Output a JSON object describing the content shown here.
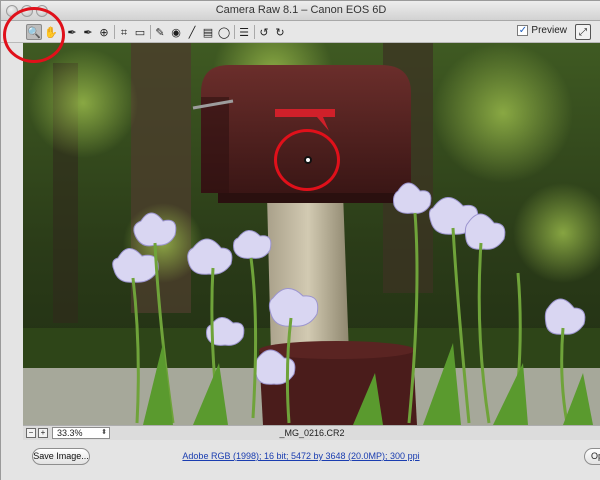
{
  "window": {
    "title": "Camera Raw 8.1  –  Canon EOS 6D"
  },
  "toolbar": {
    "tools": [
      {
        "name": "zoom-tool-icon",
        "glyph": "🔍"
      },
      {
        "name": "hand-tool-icon",
        "glyph": "✋"
      },
      {
        "name": "white-balance-tool-icon",
        "glyph": "✒"
      },
      {
        "name": "color-sampler-tool-icon",
        "glyph": "✒"
      },
      {
        "name": "targeted-adjustment-tool-icon",
        "glyph": "⊕"
      },
      {
        "name": "crop-tool-icon",
        "glyph": "⌗"
      },
      {
        "name": "straighten-tool-icon",
        "glyph": "▭"
      },
      {
        "name": "spot-removal-tool-icon",
        "glyph": "✎"
      },
      {
        "name": "red-eye-removal-tool-icon",
        "glyph": "◉"
      },
      {
        "name": "adjustment-brush-icon",
        "glyph": "╱"
      },
      {
        "name": "graduated-filter-icon",
        "glyph": "▤"
      },
      {
        "name": "radial-filter-icon",
        "glyph": "◯"
      },
      {
        "name": "preferences-icon",
        "glyph": "☰"
      },
      {
        "name": "rotate-left-icon",
        "glyph": "↺"
      },
      {
        "name": "rotate-right-icon",
        "glyph": "↻"
      }
    ],
    "preview_checked_glyph": "✓",
    "preview_label": "Preview",
    "fullscreen_glyph": "⤢"
  },
  "status": {
    "zoom_out_glyph": "−",
    "zoom_in_glyph": "+",
    "zoom_level": "33.3%",
    "zoom_arrows": "⬍",
    "filename": "_MG_0216.CR2"
  },
  "footer": {
    "save_label": "Save Image...",
    "workflow_options": "Adobe RGB (1998); 16 bit; 5472 by 3648 (20.0MP); 300 ppi",
    "open_label": "Open Image"
  },
  "colors": {
    "annotation_ring": "#e0101a",
    "mailbox": "#4a1e1c",
    "flag": "#d0202a",
    "iris": "#d9d6f2"
  }
}
